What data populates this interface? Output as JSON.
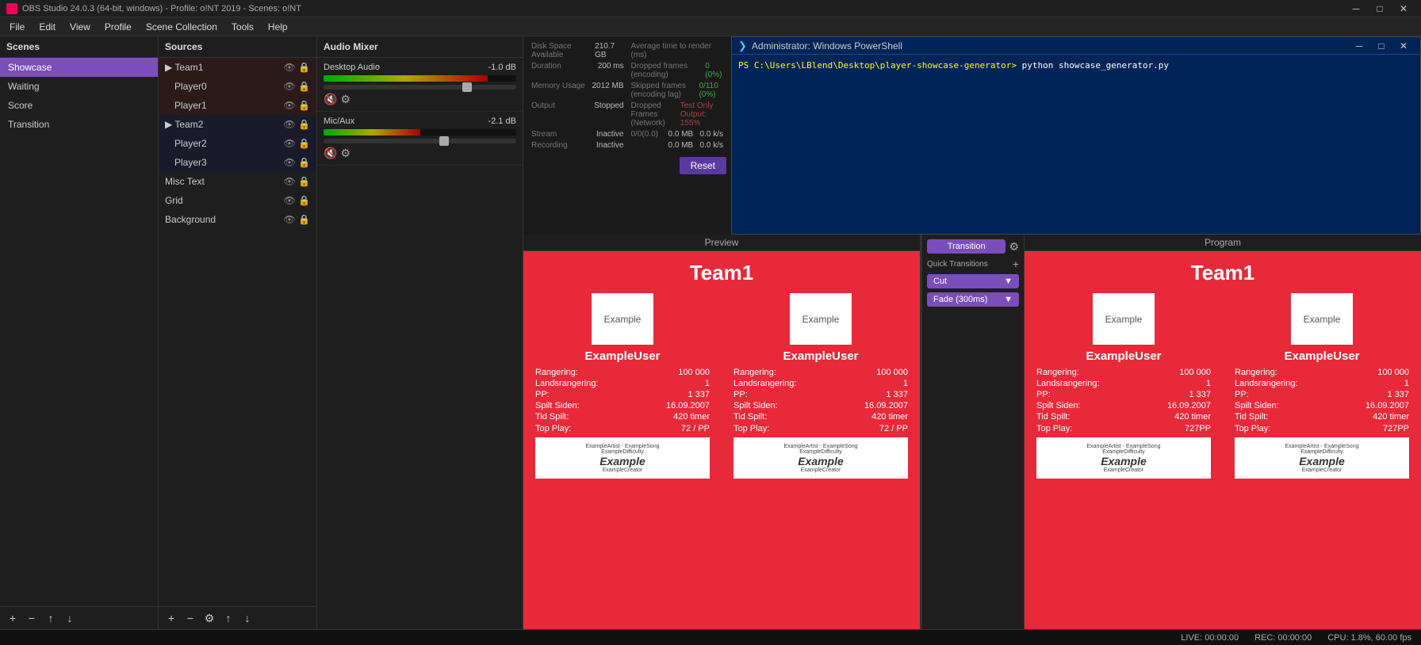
{
  "titlebar": {
    "icon": "●",
    "title": "OBS Studio 24.0.3 (64-bit, windows) - Profile: o!NT 2019 - Scenes: o!NT",
    "minimize": "─",
    "maximize": "□",
    "close": "✕"
  },
  "menubar": {
    "items": [
      "File",
      "Edit",
      "View",
      "Profile",
      "Scene Collection",
      "Tools",
      "Help"
    ]
  },
  "scenes": {
    "header": "Scenes",
    "items": [
      {
        "label": "Showcase",
        "active": true
      },
      {
        "label": "Waiting"
      },
      {
        "label": "Score"
      },
      {
        "label": "Transition"
      }
    ],
    "toolbar": [
      "+",
      "−",
      "↑",
      "↓"
    ]
  },
  "sources": {
    "header": "Sources",
    "items": [
      {
        "label": "Team1",
        "indent": false,
        "color": "red"
      },
      {
        "label": "Player0",
        "indent": true,
        "color": "red"
      },
      {
        "label": "Player1",
        "indent": true,
        "color": "red"
      },
      {
        "label": "Team2",
        "indent": false,
        "color": "blue"
      },
      {
        "label": "Player2",
        "indent": true,
        "color": "blue"
      },
      {
        "label": "Player3",
        "indent": true,
        "color": "blue"
      },
      {
        "label": "Misc Text",
        "indent": false,
        "color": "none"
      },
      {
        "label": "Grid",
        "indent": false,
        "color": "none"
      },
      {
        "label": "Background",
        "indent": false,
        "color": "none"
      }
    ],
    "toolbar": [
      "+",
      "−",
      "⚙",
      "↑",
      "↓"
    ]
  },
  "audio_mixer": {
    "header": "Audio Mixer",
    "tracks": [
      {
        "name": "Desktop Audio",
        "level": "-1.0 dB",
        "fill_percent": 85
      },
      {
        "name": "Mic/Aux",
        "level": "-2.1 dB",
        "fill_percent": 60
      }
    ]
  },
  "powershell": {
    "title": "Administrator: Windows PowerShell",
    "prompt": "PS C:\\Users\\LBlend\\Desktop\\player-showcase-generator>",
    "command": " python showcase_generator.py"
  },
  "stats": {
    "rows": [
      {
        "label": "Disk Space Available",
        "value": "210.7 GB"
      },
      {
        "label": "Average time to render (ms)",
        "value": ""
      },
      {
        "label": "Duration",
        "value": "200 ms"
      },
      {
        "label": "Dropped frames (due to encoding)",
        "value": "0 (0%)"
      },
      {
        "label": "Memory Usage",
        "value": "2012 MB"
      },
      {
        "label": "Skipped frames due to encoding lag",
        "value": "0/110 (0%)"
      },
      {
        "label": "Output",
        "value": "Stopped"
      },
      {
        "label": "Dropped Frames (Network)",
        "value": "Test Only Output: 155%"
      },
      {
        "label": "Stream",
        "value": "Inactive"
      },
      {
        "label": "0/0 (0.0)",
        "value": "0.0 MB"
      },
      {
        "label": "Recording",
        "value": "Inactive"
      },
      {
        "label": "",
        "value": "0.0 MB"
      }
    ]
  },
  "transition": {
    "btn_label": "Transition",
    "quick_label": "Quick Transitions",
    "add_icon": "+",
    "cut_label": "Cut",
    "fade_label": "Fade (300ms)"
  },
  "preview": {
    "label": "Preview",
    "team_name": "Team1",
    "players": [
      {
        "avatar_text": "Example",
        "name": "ExampleUser",
        "stats": [
          {
            "label": "Rangering:",
            "value": "100 000"
          },
          {
            "label": "Landsrangering:",
            "value": "1"
          },
          {
            "label": "PP:",
            "value": "1 337"
          },
          {
            "label": "Spilt Siden:",
            "value": "16.09.2007"
          },
          {
            "label": "Tid Spilt:",
            "value": "420 timer"
          }
        ],
        "top_play_label": "Top Play:",
        "top_play_value": "72 / PP",
        "album_meta": "ExampleArtist - ExampleSong",
        "album_meta2": "ExampleDifficulty",
        "album_main": "Example",
        "album_creator": "ExampleCreator"
      },
      {
        "avatar_text": "Example",
        "name": "ExampleUser",
        "stats": [
          {
            "label": "Rangering:",
            "value": "100 000"
          },
          {
            "label": "Landsrangering:",
            "value": "1"
          },
          {
            "label": "PP:",
            "value": "1 337"
          },
          {
            "label": "Spilt Siden:",
            "value": "16.09.2007"
          },
          {
            "label": "Tid Spilt:",
            "value": "420 timer"
          }
        ],
        "top_play_label": "Top Play:",
        "top_play_value": "72 / PP",
        "album_meta": "ExampleArtist - ExampleSong",
        "album_meta2": "ExampleDifficulty",
        "album_main": "Example",
        "album_creator": "ExampleCreator"
      }
    ]
  },
  "program": {
    "label": "Program",
    "team_name": "Team1",
    "players": [
      {
        "avatar_text": "Example",
        "name": "ExampleUser",
        "stats": [
          {
            "label": "Rangering:",
            "value": "100 000"
          },
          {
            "label": "Landsrangering:",
            "value": "1"
          },
          {
            "label": "PP:",
            "value": "1 337"
          },
          {
            "label": "Spilt Siden:",
            "value": "16.09.2007"
          },
          {
            "label": "Tid Spilt:",
            "value": "420 timer"
          }
        ],
        "top_play_label": "Top Play:",
        "top_play_value": "727PP",
        "album_meta": "ExampleArtist - ExampleSong",
        "album_meta2": "ExampleDifficulty",
        "album_main": "Example",
        "album_creator": "ExampleCreator"
      },
      {
        "avatar_text": "Example",
        "name": "ExampleUser",
        "stats": [
          {
            "label": "Rangering:",
            "value": "100 000"
          },
          {
            "label": "Landsrangering:",
            "value": "1"
          },
          {
            "label": "PP:",
            "value": "1 337"
          },
          {
            "label": "Spilt Siden:",
            "value": "16.09.2007"
          },
          {
            "label": "Tid Spilt:",
            "value": "420 timer"
          }
        ],
        "top_play_label": "Top Play:",
        "top_play_value": "727PP",
        "album_meta": "ExampleArtist - ExampleSong",
        "album_meta2": "ExampleDifficulty",
        "album_main": "Example",
        "album_creator": "ExampleCreator"
      }
    ]
  },
  "statusbar": {
    "live": "LIVE: 00:00:00",
    "rec": "REC: 00:00:00",
    "perf": "CPU: 1.8%, 60.00 fps"
  },
  "reset_btn": "Reset"
}
